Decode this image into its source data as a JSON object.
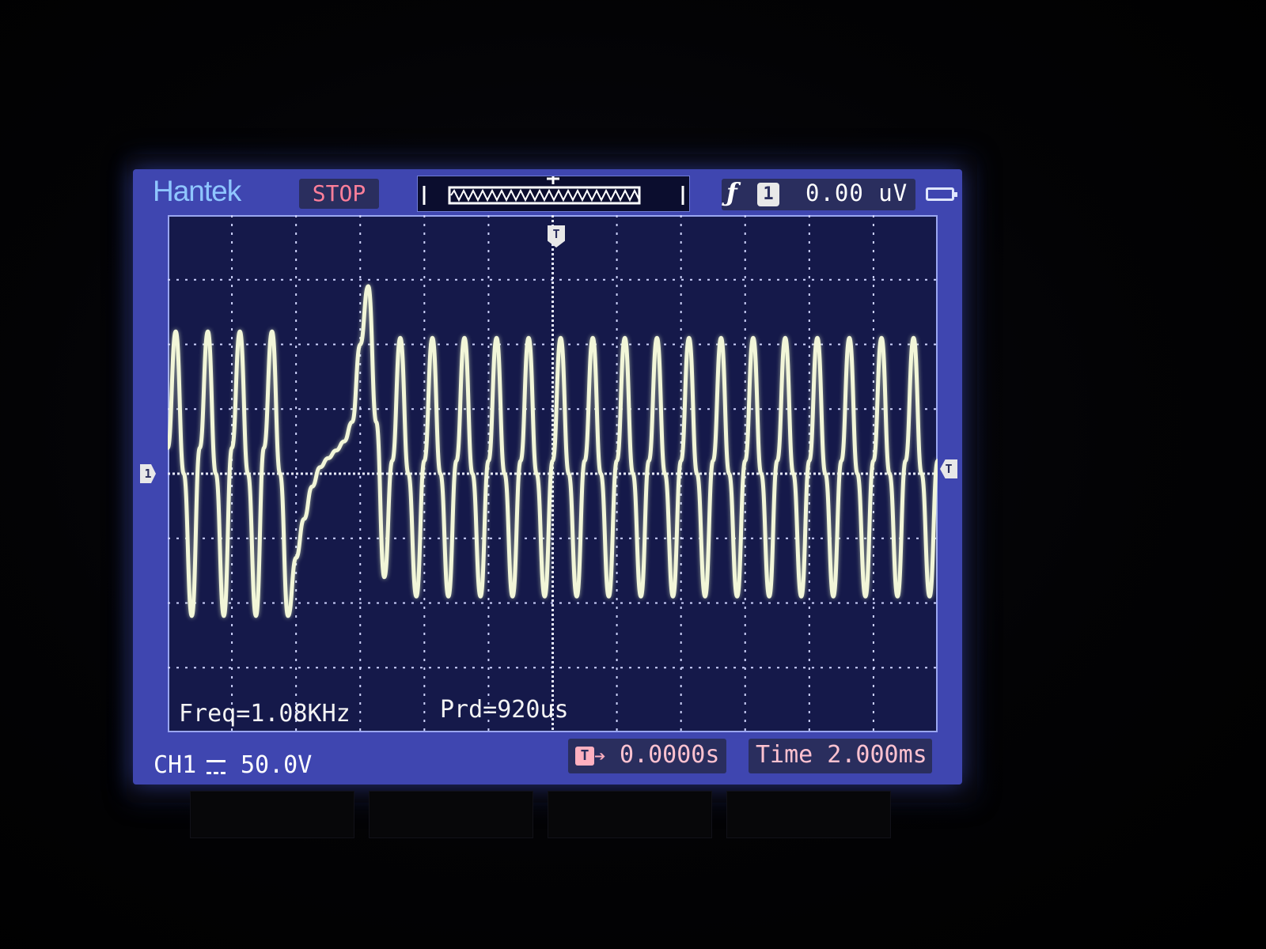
{
  "header": {
    "brand": "Hantek",
    "run_state": "STOP",
    "trigger_edge_icon": "rising-edge-icon",
    "trigger_channel": "1",
    "trigger_level": "0.00 uV"
  },
  "measurements": {
    "frequency": "Freq=1.08KHz",
    "period": "Prd=920us"
  },
  "footer": {
    "channel": "CH1",
    "coupling_icon": "dc-coupling-icon",
    "volts_per_div": "50.0V",
    "trigger_position": "0.0000s",
    "timebase": "Time 2.000ms"
  },
  "markers": {
    "channel_level": "1",
    "trigger_level": "T",
    "trigger_position": "T"
  },
  "colors": {
    "screen_blue": "#3f46b0",
    "plot_bg": "#15194a",
    "trace": "#f2f6d8",
    "brand": "#8fc6ff",
    "stop": "#ff7f9a",
    "accent_pink": "#ffc2d0"
  },
  "chart_data": {
    "type": "line",
    "xlim": [
      -9.6,
      9.6
    ],
    "ylim": [
      -200,
      200
    ],
    "grid": true,
    "series": [
      {
        "x": [
          -9.6,
          -9.4,
          -9.2,
          -9.0,
          -8.8,
          -8.6,
          -8.4,
          -8.2,
          -8.0,
          -7.8,
          -7.6,
          -7.4,
          -7.2,
          -7.0,
          -6.8,
          -6.6,
          -6.4,
          -6.2,
          -6.0,
          -5.8,
          -5.6,
          -5.4,
          -5.2,
          -5.0,
          -4.8,
          -4.6,
          -4.4,
          -4.2,
          -4.0,
          -3.8,
          -3.6,
          -3.4,
          -3.2,
          -3.0,
          -2.8,
          -2.6,
          -2.4,
          -2.2,
          -2.0,
          -1.8,
          -1.6,
          -1.4,
          -1.2,
          -1.0,
          -0.8,
          -0.6,
          -0.4,
          -0.2,
          0.0,
          0.2,
          0.4,
          0.6,
          0.8,
          1.0,
          1.2,
          1.4,
          1.6,
          1.8,
          2.0,
          2.2,
          2.4,
          2.6,
          2.8,
          3.0,
          3.2,
          3.4,
          3.6,
          3.8,
          4.0,
          4.2,
          4.4,
          4.6,
          4.8,
          5.0,
          5.2,
          5.4,
          5.6,
          5.8,
          6.0,
          6.2,
          6.4,
          6.6,
          6.8,
          7.0,
          7.2,
          7.4,
          7.6,
          7.8,
          8.0,
          8.2,
          8.4,
          8.6,
          8.8,
          9.0,
          9.2,
          9.4,
          9.6
        ],
        "values": [
          20,
          110,
          0,
          -110,
          20,
          110,
          0,
          -110,
          20,
          110,
          0,
          -110,
          20,
          110,
          0,
          -110,
          -65,
          -35,
          -10,
          5,
          12,
          18,
          25,
          40,
          100,
          145,
          40,
          -80,
          10,
          105,
          0,
          -95,
          10,
          105,
          0,
          -95,
          10,
          105,
          0,
          -95,
          10,
          105,
          0,
          -95,
          10,
          105,
          0,
          -95,
          10,
          105,
          0,
          -95,
          10,
          105,
          0,
          -95,
          10,
          105,
          0,
          -95,
          10,
          105,
          0,
          -95,
          10,
          105,
          0,
          -95,
          10,
          105,
          0,
          -95,
          10,
          105,
          0,
          -95,
          10,
          105,
          0,
          -95,
          10,
          105,
          0,
          -95,
          10,
          105,
          0,
          -95,
          10,
          105,
          0,
          -95,
          10,
          105,
          0,
          -95,
          10
        ]
      }
    ]
  }
}
